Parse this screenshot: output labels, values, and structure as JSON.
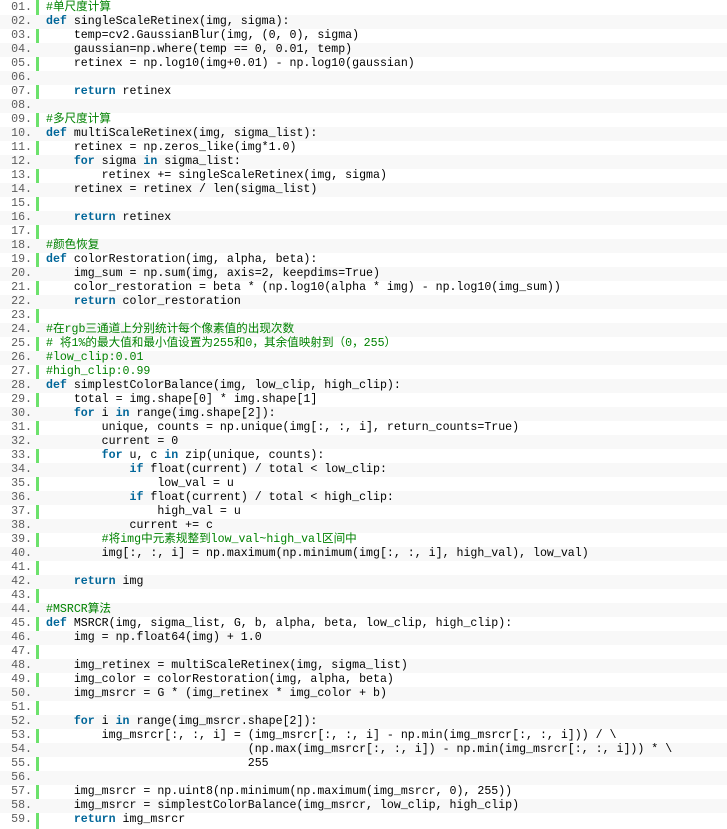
{
  "colors": {
    "gutter_rule": "#6ce26c",
    "line_number": "#5c5c5c",
    "keyword": "#006699",
    "comment": "#008200",
    "text": "#000000",
    "alt_row": "#f8f8f8"
  },
  "lines": [
    {
      "n": "01.",
      "tokens": [
        {
          "t": "#单尺度计算",
          "c": "cm"
        }
      ]
    },
    {
      "n": "02.",
      "tokens": [
        {
          "t": "def",
          "c": "kw"
        },
        {
          "t": " singleScaleRetinex(img, sigma):",
          "c": "tok"
        }
      ]
    },
    {
      "n": "03.",
      "tokens": [
        {
          "t": "    temp=cv2.GaussianBlur(img, (0, 0), sigma)",
          "c": "tok"
        }
      ]
    },
    {
      "n": "04.",
      "tokens": [
        {
          "t": "    gaussian=np.where(temp == 0, 0.01, temp)",
          "c": "tok"
        }
      ]
    },
    {
      "n": "05.",
      "tokens": [
        {
          "t": "    retinex = np.log10(img+0.01) - np.log10(gaussian)",
          "c": "tok"
        }
      ]
    },
    {
      "n": "06.",
      "tokens": []
    },
    {
      "n": "07.",
      "tokens": [
        {
          "t": "    ",
          "c": "tok"
        },
        {
          "t": "return",
          "c": "kw"
        },
        {
          "t": " retinex",
          "c": "tok"
        }
      ]
    },
    {
      "n": "08.",
      "tokens": []
    },
    {
      "n": "09.",
      "tokens": [
        {
          "t": "#多尺度计算",
          "c": "cm"
        }
      ]
    },
    {
      "n": "10.",
      "tokens": [
        {
          "t": "def",
          "c": "kw"
        },
        {
          "t": " multiScaleRetinex(img, sigma_list):",
          "c": "tok"
        }
      ]
    },
    {
      "n": "11.",
      "tokens": [
        {
          "t": "    retinex = np.zeros_like(img*1.0)",
          "c": "tok"
        }
      ]
    },
    {
      "n": "12.",
      "tokens": [
        {
          "t": "    ",
          "c": "tok"
        },
        {
          "t": "for",
          "c": "kw"
        },
        {
          "t": " sigma ",
          "c": "tok"
        },
        {
          "t": "in",
          "c": "kw"
        },
        {
          "t": " sigma_list:",
          "c": "tok"
        }
      ]
    },
    {
      "n": "13.",
      "tokens": [
        {
          "t": "        retinex += singleScaleRetinex(img, sigma)",
          "c": "tok"
        }
      ]
    },
    {
      "n": "14.",
      "tokens": [
        {
          "t": "    retinex = retinex / len(sigma_list)",
          "c": "tok"
        }
      ]
    },
    {
      "n": "15.",
      "tokens": []
    },
    {
      "n": "16.",
      "tokens": [
        {
          "t": "    ",
          "c": "tok"
        },
        {
          "t": "return",
          "c": "kw"
        },
        {
          "t": " retinex",
          "c": "tok"
        }
      ]
    },
    {
      "n": "17.",
      "tokens": []
    },
    {
      "n": "18.",
      "tokens": [
        {
          "t": "#颜色恢复",
          "c": "cm"
        }
      ]
    },
    {
      "n": "19.",
      "tokens": [
        {
          "t": "def",
          "c": "kw"
        },
        {
          "t": " colorRestoration(img, alpha, beta):",
          "c": "tok"
        }
      ]
    },
    {
      "n": "20.",
      "tokens": [
        {
          "t": "    img_sum = np.sum(img, axis=2, keepdims=True)",
          "c": "tok"
        }
      ]
    },
    {
      "n": "21.",
      "tokens": [
        {
          "t": "    color_restoration = beta * (np.log10(alpha * img) - np.log10(img_sum))",
          "c": "tok"
        }
      ]
    },
    {
      "n": "22.",
      "tokens": [
        {
          "t": "    ",
          "c": "tok"
        },
        {
          "t": "return",
          "c": "kw"
        },
        {
          "t": " color_restoration",
          "c": "tok"
        }
      ]
    },
    {
      "n": "23.",
      "tokens": []
    },
    {
      "n": "24.",
      "tokens": [
        {
          "t": "#在rgb三通道上分别统计每个像素值的出现次数",
          "c": "cm"
        }
      ]
    },
    {
      "n": "25.",
      "tokens": [
        {
          "t": "# 将1%的最大值和最小值设置为255和0，其余值映射到（0，255）",
          "c": "cm"
        }
      ]
    },
    {
      "n": "26.",
      "tokens": [
        {
          "t": "#low_clip:0.01",
          "c": "cm"
        }
      ]
    },
    {
      "n": "27.",
      "tokens": [
        {
          "t": "#high_clip:0.99",
          "c": "cm"
        }
      ]
    },
    {
      "n": "28.",
      "tokens": [
        {
          "t": "def",
          "c": "kw"
        },
        {
          "t": " simplestColorBalance(img, low_clip, high_clip):",
          "c": "tok"
        }
      ]
    },
    {
      "n": "29.",
      "tokens": [
        {
          "t": "    total = img.shape[0] * img.shape[1]",
          "c": "tok"
        }
      ]
    },
    {
      "n": "30.",
      "tokens": [
        {
          "t": "    ",
          "c": "tok"
        },
        {
          "t": "for",
          "c": "kw"
        },
        {
          "t": " i ",
          "c": "tok"
        },
        {
          "t": "in",
          "c": "kw"
        },
        {
          "t": " range(img.shape[2]):",
          "c": "tok"
        }
      ]
    },
    {
      "n": "31.",
      "tokens": [
        {
          "t": "        unique, counts = np.unique(img[:, :, i], return_counts=True)",
          "c": "tok"
        }
      ]
    },
    {
      "n": "32.",
      "tokens": [
        {
          "t": "        current = 0",
          "c": "tok"
        }
      ]
    },
    {
      "n": "33.",
      "tokens": [
        {
          "t": "        ",
          "c": "tok"
        },
        {
          "t": "for",
          "c": "kw"
        },
        {
          "t": " u, c ",
          "c": "tok"
        },
        {
          "t": "in",
          "c": "kw"
        },
        {
          "t": " zip(unique, counts):",
          "c": "tok"
        }
      ]
    },
    {
      "n": "34.",
      "tokens": [
        {
          "t": "            ",
          "c": "tok"
        },
        {
          "t": "if",
          "c": "kw"
        },
        {
          "t": " float(current) / total < low_clip:",
          "c": "tok"
        }
      ]
    },
    {
      "n": "35.",
      "tokens": [
        {
          "t": "                low_val = u",
          "c": "tok"
        }
      ]
    },
    {
      "n": "36.",
      "tokens": [
        {
          "t": "            ",
          "c": "tok"
        },
        {
          "t": "if",
          "c": "kw"
        },
        {
          "t": " float(current) / total < high_clip:",
          "c": "tok"
        }
      ]
    },
    {
      "n": "37.",
      "tokens": [
        {
          "t": "                high_val = u",
          "c": "tok"
        }
      ]
    },
    {
      "n": "38.",
      "tokens": [
        {
          "t": "            current += c",
          "c": "tok"
        }
      ]
    },
    {
      "n": "39.",
      "tokens": [
        {
          "t": "        ",
          "c": "tok"
        },
        {
          "t": "#将img中元素规整到low_val~high_val区间中",
          "c": "cm"
        }
      ]
    },
    {
      "n": "40.",
      "tokens": [
        {
          "t": "        img[:, :, i] = np.maximum(np.minimum(img[:, :, i], high_val), low_val)",
          "c": "tok"
        }
      ]
    },
    {
      "n": "41.",
      "tokens": []
    },
    {
      "n": "42.",
      "tokens": [
        {
          "t": "    ",
          "c": "tok"
        },
        {
          "t": "return",
          "c": "kw"
        },
        {
          "t": " img",
          "c": "tok"
        }
      ]
    },
    {
      "n": "43.",
      "tokens": []
    },
    {
      "n": "44.",
      "tokens": [
        {
          "t": "#MSRCR算法",
          "c": "cm"
        }
      ]
    },
    {
      "n": "45.",
      "tokens": [
        {
          "t": "def",
          "c": "kw"
        },
        {
          "t": " MSRCR(img, sigma_list, G, b, alpha, beta, low_clip, high_clip):",
          "c": "tok"
        }
      ]
    },
    {
      "n": "46.",
      "tokens": [
        {
          "t": "    img = np.float64(img) + 1.0",
          "c": "tok"
        }
      ]
    },
    {
      "n": "47.",
      "tokens": []
    },
    {
      "n": "48.",
      "tokens": [
        {
          "t": "    img_retinex = multiScaleRetinex(img, sigma_list)",
          "c": "tok"
        }
      ]
    },
    {
      "n": "49.",
      "tokens": [
        {
          "t": "    img_color = colorRestoration(img, alpha, beta)",
          "c": "tok"
        }
      ]
    },
    {
      "n": "50.",
      "tokens": [
        {
          "t": "    img_msrcr = G * (img_retinex * img_color + b)",
          "c": "tok"
        }
      ]
    },
    {
      "n": "51.",
      "tokens": []
    },
    {
      "n": "52.",
      "tokens": [
        {
          "t": "    ",
          "c": "tok"
        },
        {
          "t": "for",
          "c": "kw"
        },
        {
          "t": " i ",
          "c": "tok"
        },
        {
          "t": "in",
          "c": "kw"
        },
        {
          "t": " range(img_msrcr.shape[2]):",
          "c": "tok"
        }
      ]
    },
    {
      "n": "53.",
      "tokens": [
        {
          "t": "        img_msrcr[:, :, i] = (img_msrcr[:, :, i] - np.min(img_msrcr[:, :, i])) / \\",
          "c": "tok"
        }
      ]
    },
    {
      "n": "54.",
      "tokens": [
        {
          "t": "                             (np.max(img_msrcr[:, :, i]) - np.min(img_msrcr[:, :, i])) * \\",
          "c": "tok"
        }
      ]
    },
    {
      "n": "55.",
      "tokens": [
        {
          "t": "                             255",
          "c": "tok"
        }
      ]
    },
    {
      "n": "56.",
      "tokens": []
    },
    {
      "n": "57.",
      "tokens": [
        {
          "t": "    img_msrcr = np.uint8(np.minimum(np.maximum(img_msrcr, 0), 255))",
          "c": "tok"
        }
      ]
    },
    {
      "n": "58.",
      "tokens": [
        {
          "t": "    img_msrcr = simplestColorBalance(img_msrcr, low_clip, high_clip)",
          "c": "tok"
        }
      ]
    },
    {
      "n": "59.",
      "tokens": [
        {
          "t": "    ",
          "c": "tok"
        },
        {
          "t": "return",
          "c": "kw"
        },
        {
          "t": " img_msrcr",
          "c": "tok"
        }
      ]
    }
  ]
}
